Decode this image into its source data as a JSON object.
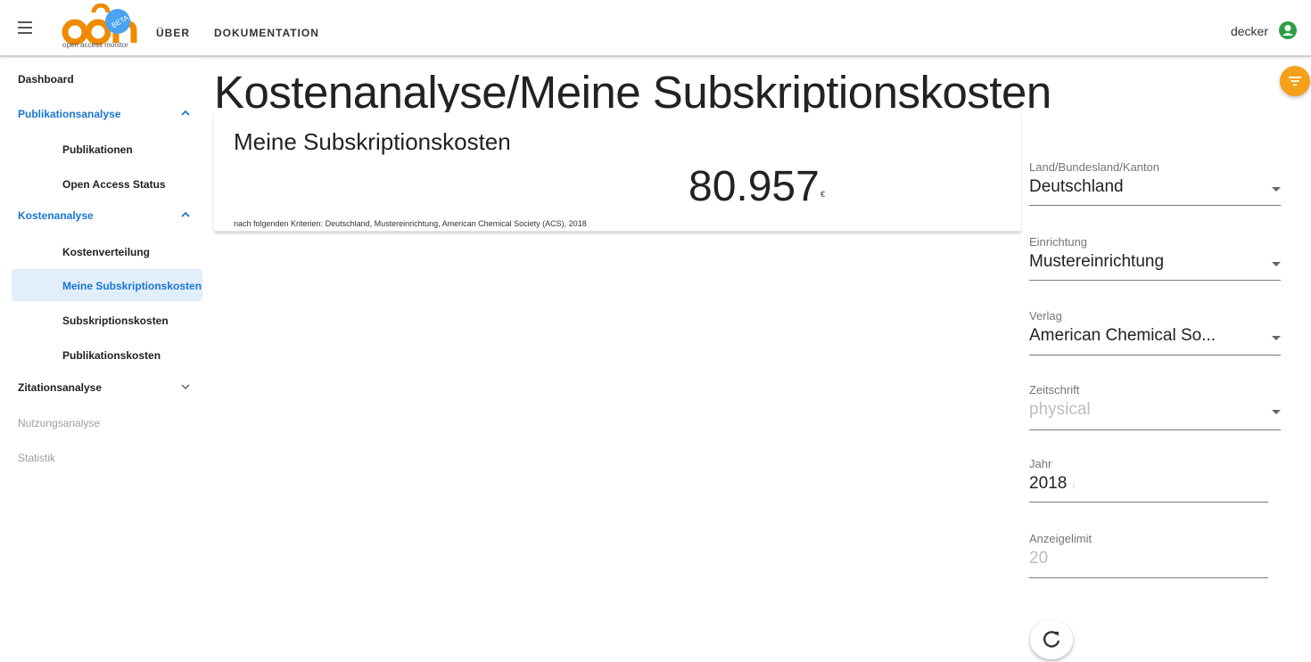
{
  "header": {
    "logo_text": "oam",
    "logo_badge": "BETA",
    "logo_subtitle": "open access monitor",
    "nav": [
      "ÜBER",
      "DOKUMENTATION"
    ],
    "user": "decker"
  },
  "sidebar": {
    "items": [
      {
        "label": "Dashboard"
      },
      {
        "label": "Publikationsanalyse"
      },
      {
        "label": "Publikationen"
      },
      {
        "label": "Open Access Status"
      },
      {
        "label": "Kostenanalyse"
      },
      {
        "label": "Kostenverteilung"
      },
      {
        "label": "Meine Subskriptionskosten"
      },
      {
        "label": "Subskriptionskosten"
      },
      {
        "label": "Publikationskosten"
      },
      {
        "label": "Zitationsanalyse"
      },
      {
        "label": "Nutzungsanalyse"
      },
      {
        "label": "Statistik"
      }
    ]
  },
  "main": {
    "title": "Kostenanalyse/Meine Subskriptionskosten",
    "card": {
      "title": "Meine Subskriptionskosten",
      "value": "80.957",
      "unit": "€",
      "criteria": "nach folgenden Kriterien: Deutschland, Mustereinrichtung, American Chemical Society (ACS), 2018"
    }
  },
  "filters": {
    "land": {
      "label": "Land/Bundesland/Kanton",
      "value": "Deutschland"
    },
    "einrichtung": {
      "label": "Einrichtung",
      "value": "Mustereinrichtung"
    },
    "verlag": {
      "label": "Verlag",
      "value": "American Chemical So..."
    },
    "zeitschrift": {
      "label": "Zeitschrift",
      "placeholder": "physical"
    },
    "jahr": {
      "label": "Jahr",
      "value": "2018"
    },
    "anzeigelimit": {
      "label": "Anzeigelimit",
      "placeholder": "20"
    }
  },
  "colors": {
    "accent_blue": "#1976d2",
    "filter_orange": "#f5a01a",
    "logo_orange": "#f08a00",
    "badge_blue": "#4aa3f0",
    "user_green": "#2e9e44"
  }
}
